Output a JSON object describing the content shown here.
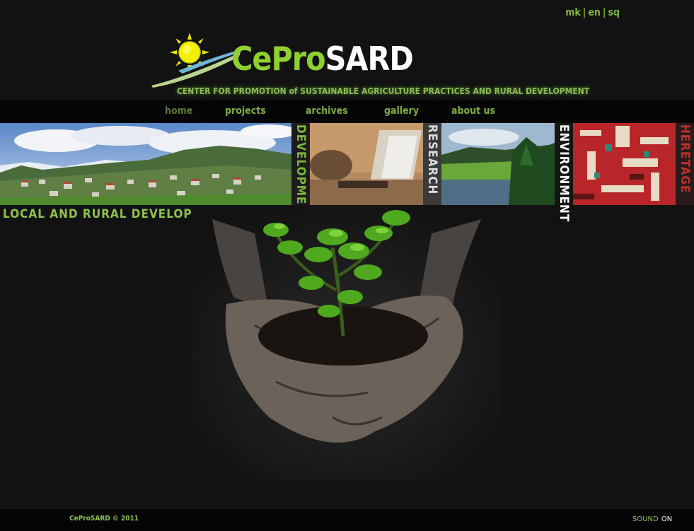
{
  "languages": [
    "mk",
    "en",
    "sq"
  ],
  "logo": {
    "brand_part1": "CePro",
    "brand_part2": "SARD",
    "tagline": "CENTER FOR PROMOTION of SUSTAINABLE AGRICULTURE PRACTICES AND RURAL DEVELOPMENT"
  },
  "nav": {
    "home": "home",
    "projects": "projects",
    "archives": "archives",
    "gallery": "gallery",
    "about": "about us"
  },
  "banner": {
    "development": "DEVELOPMENT",
    "research": "RESEARCH",
    "environment": "ENVIRONMENT",
    "heretage": "HERETAGE"
  },
  "subtitle": "LOCAL AND RURAL DEVELOPEMENT",
  "footer": {
    "copyright": "CeProSARD © 2011",
    "sound_label": "SOUND",
    "sound_state": "ON"
  },
  "colors": {
    "accent": "#8fc24a",
    "background": "#121212",
    "heretage": "#c0302a"
  }
}
